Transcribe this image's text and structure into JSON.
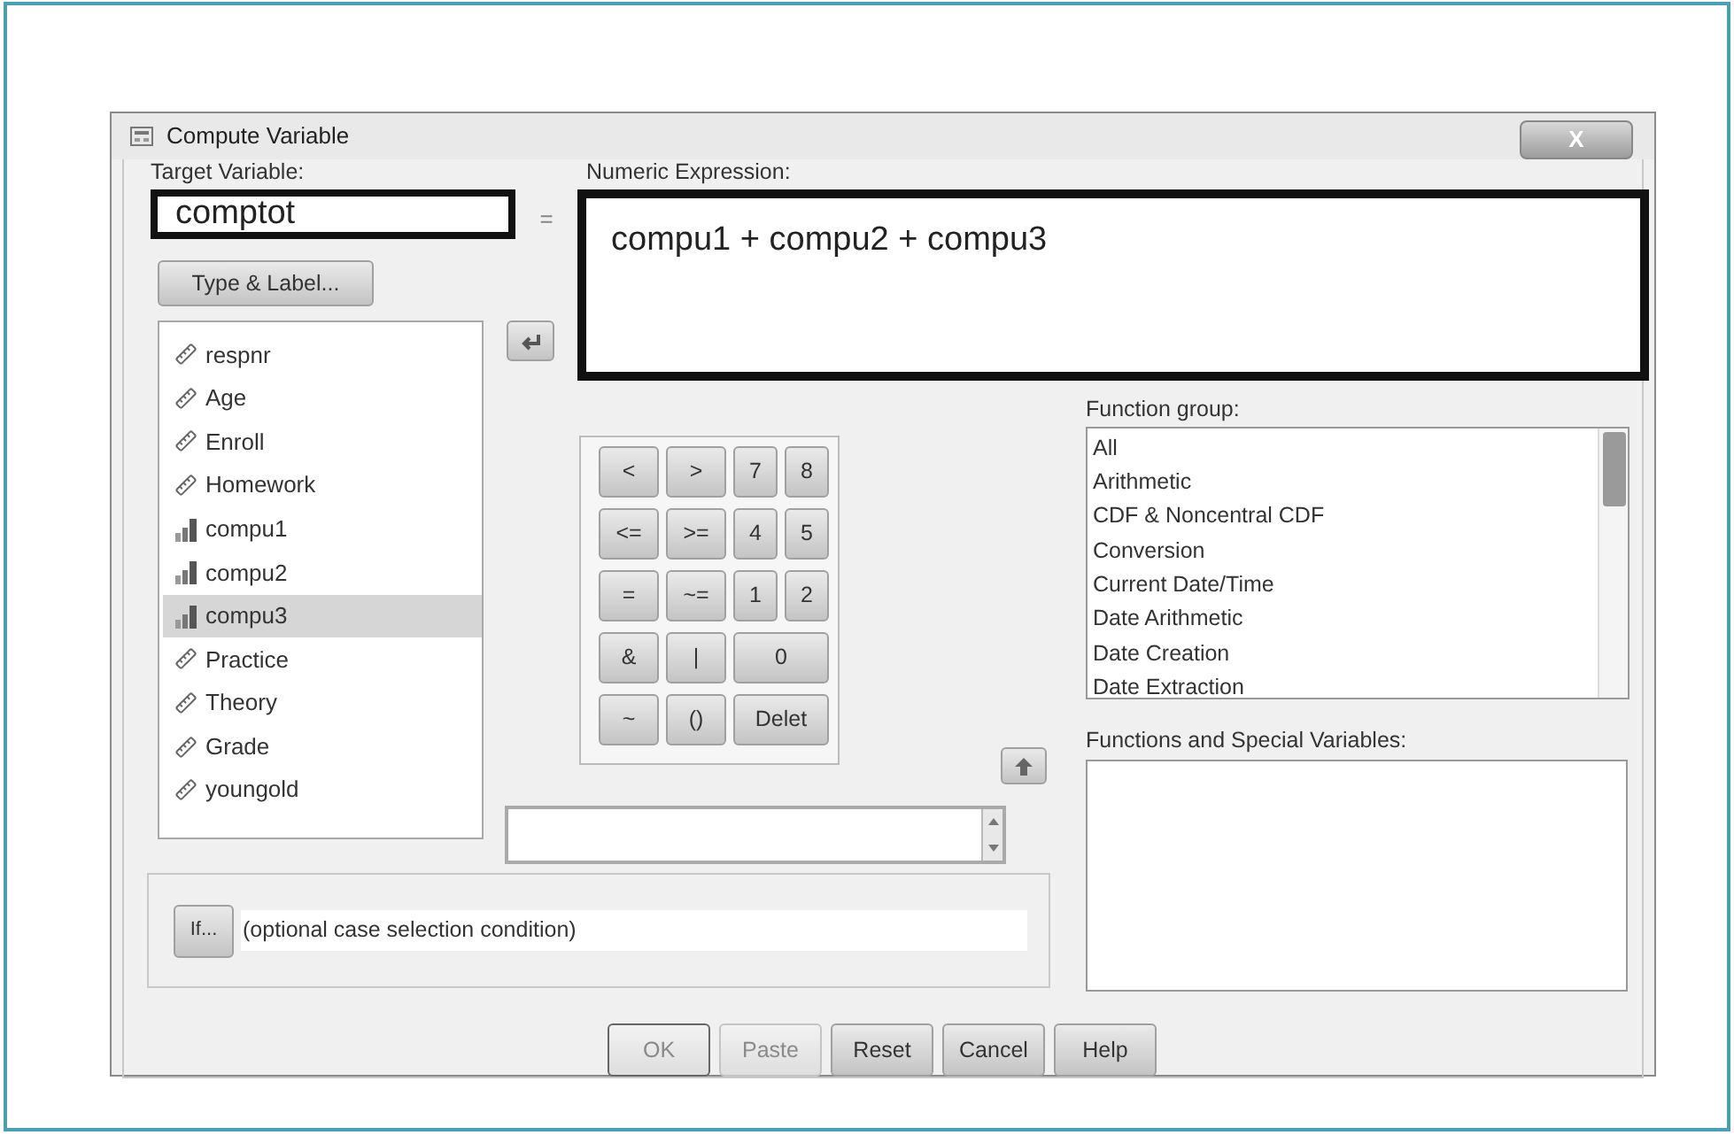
{
  "window": {
    "title": "Compute Variable",
    "close_label": "X"
  },
  "target_variable": {
    "label": "Target Variable:",
    "value": "comptot"
  },
  "equals_sign": "=",
  "numeric_expression": {
    "label": "Numeric Expression:",
    "value": "compu1 + compu2 + compu3"
  },
  "type_label_button": "Type & Label...",
  "variables": [
    {
      "name": "respnr",
      "kind": "scale",
      "selected": false
    },
    {
      "name": "Age",
      "kind": "scale",
      "selected": false
    },
    {
      "name": "Enroll",
      "kind": "scale",
      "selected": false
    },
    {
      "name": "Homework",
      "kind": "scale",
      "selected": false
    },
    {
      "name": "compu1",
      "kind": "ordinal",
      "selected": false
    },
    {
      "name": "compu2",
      "kind": "ordinal",
      "selected": false
    },
    {
      "name": "compu3",
      "kind": "ordinal",
      "selected": true
    },
    {
      "name": "Practice",
      "kind": "scale",
      "selected": false
    },
    {
      "name": "Theory",
      "kind": "scale",
      "selected": false
    },
    {
      "name": "Grade",
      "kind": "scale",
      "selected": false
    },
    {
      "name": "youngold",
      "kind": "scale",
      "selected": false
    }
  ],
  "keypad": [
    {
      "label": "<",
      "kind": "operator"
    },
    {
      "label": ">",
      "kind": "operator"
    },
    {
      "label": "7",
      "kind": "digit"
    },
    {
      "label": "8",
      "kind": "digit"
    },
    {
      "label": "<=",
      "kind": "operator"
    },
    {
      "label": ">=",
      "kind": "operator"
    },
    {
      "label": "4",
      "kind": "digit"
    },
    {
      "label": "5",
      "kind": "digit"
    },
    {
      "label": "=",
      "kind": "operator"
    },
    {
      "label": "~=",
      "kind": "operator"
    },
    {
      "label": "1",
      "kind": "digit"
    },
    {
      "label": "2",
      "kind": "digit"
    },
    {
      "label": "&",
      "kind": "operator"
    },
    {
      "label": "|",
      "kind": "operator"
    },
    {
      "label": "0",
      "kind": "wide"
    },
    {
      "label": "~",
      "kind": "operator"
    },
    {
      "label": "()",
      "kind": "operator"
    },
    {
      "label": "Delet",
      "kind": "wide"
    }
  ],
  "function_group": {
    "label": "Function group:",
    "items": [
      "All",
      "Arithmetic",
      "CDF & Noncentral CDF",
      "Conversion",
      "Current Date/Time",
      "Date Arithmetic",
      "Date Creation",
      "Date Extraction"
    ]
  },
  "functions_special_variables": {
    "label": "Functions and Special Variables:"
  },
  "if_condition": {
    "button": "If...",
    "text": "(optional case selection condition)"
  },
  "buttons": [
    {
      "label": "OK",
      "disabled": true
    },
    {
      "label": "Paste",
      "disabled": true
    },
    {
      "label": "Reset",
      "disabled": false
    },
    {
      "label": "Cancel",
      "disabled": false
    },
    {
      "label": "Help",
      "disabled": false
    }
  ]
}
